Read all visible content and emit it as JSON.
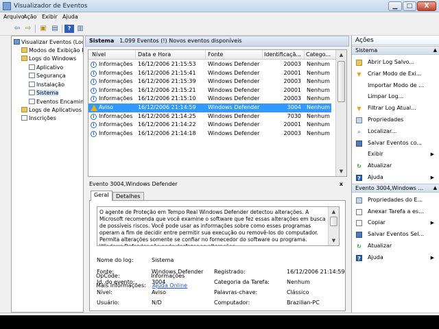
{
  "window": {
    "title": "Visualizador de Eventos"
  },
  "menu": [
    "Arquivo",
    "Ação",
    "Exibir",
    "Ajuda"
  ],
  "tree": [
    {
      "label": "Visualizar Eventos (Local",
      "icon": "monitor-icon",
      "indent": 0
    },
    {
      "label": "Modos de Exibição P",
      "icon": "folder-icon",
      "indent": 1
    },
    {
      "label": "Logs do Windows",
      "icon": "folder-icon",
      "indent": 1
    },
    {
      "label": "Aplicativo",
      "icon": "log-icon",
      "indent": 2
    },
    {
      "label": "Segurança",
      "icon": "log-icon",
      "indent": 2
    },
    {
      "label": "Instalação",
      "icon": "log-icon",
      "indent": 2
    },
    {
      "label": "Sistema",
      "icon": "log-icon",
      "indent": 2,
      "selected": true
    },
    {
      "label": "Eventos Encamin",
      "icon": "log-icon",
      "indent": 2
    },
    {
      "label": "Logs de Aplicativos e",
      "icon": "folder-icon",
      "indent": 1
    },
    {
      "label": "Inscrições",
      "icon": "log-icon",
      "indent": 1
    }
  ],
  "summary": {
    "log": "Sistema",
    "text": "1.099 Eventos (!) Novos eventos disponíveis"
  },
  "grid": {
    "columns": [
      "Nível",
      "Data e Hora",
      "Fonte",
      "Identificaçã...",
      "Catego..."
    ],
    "rows": [
      {
        "level": "Informações",
        "type": "info",
        "date": "16/12/2006 21:15:53",
        "source": "Windows Defender",
        "id": "20003",
        "cat": "Nenhum"
      },
      {
        "level": "Informações",
        "type": "info",
        "date": "16/12/2006 21:15:41",
        "source": "Windows Defender",
        "id": "20001",
        "cat": "Nenhum"
      },
      {
        "level": "Informações",
        "type": "info",
        "date": "16/12/2006 21:15:39",
        "source": "Windows Defender",
        "id": "20003",
        "cat": "Nenhum"
      },
      {
        "level": "Informações",
        "type": "info",
        "date": "16/12/2006 21:15:21",
        "source": "Windows Defender",
        "id": "20001",
        "cat": "Nenhum"
      },
      {
        "level": "Informações",
        "type": "info",
        "date": "16/12/2006 21:15:10",
        "source": "Windows Defender",
        "id": "20003",
        "cat": "Nenhum"
      },
      {
        "level": "Aviso",
        "type": "warn",
        "date": "16/12/2006 21:14:59",
        "source": "Windows Defender",
        "id": "3004",
        "cat": "Nenhum",
        "selected": true
      },
      {
        "level": "Informações",
        "type": "info",
        "date": "16/12/2006 21:14:25",
        "source": "Windows Defender",
        "id": "7030",
        "cat": "Nenhum"
      },
      {
        "level": "Informações",
        "type": "info",
        "date": "16/12/2006 21:14:22",
        "source": "Windows Defender",
        "id": "20001",
        "cat": "Nenhum"
      },
      {
        "level": "Informações",
        "type": "info",
        "date": "16/12/2006 21:14:18",
        "source": "Windows Defender",
        "id": "20003",
        "cat": "Nenhum"
      }
    ]
  },
  "detail": {
    "title": "Evento 3004,Windows Defender",
    "close": "x",
    "tabs": [
      "Geral",
      "Detalhes"
    ],
    "description": "O agente de Proteção em Tempo Real Windows Defender detectou alterações. A Microsoft recomenda que você examine o software que fez essas alterações em busca de possíveis riscos. Você pode usar as informações sobre como esses programas operam a fim de decidir entre permitir sua execução ou removê-los do computador.  Permita alterações somente se confiar no fornecedor do software ou programa. Windows Defender não pode desfazer as alterações",
    "fields": {
      "log_label": "Nome do log:",
      "log_value": "Sistema",
      "source_label": "Fonte:",
      "source_value": "Windows Defender",
      "registered_label": "Registrado:",
      "registered_value": "16/12/2006 21:14:59",
      "id_label": "Id. do evento:",
      "id_value": "3004",
      "task_label": "Categoria da Tarefa:",
      "task_value": "Nenhum",
      "level_label": "Nível:",
      "level_value": "Aviso",
      "keywords_label": "Palavras-chave:",
      "keywords_value": "Clássico",
      "user_label": "Usuário:",
      "user_value": "N/D",
      "computer_label": "Computador:",
      "computer_value": "Brazilian-PC",
      "opcode_label": "OpCode:",
      "opcode_value": "Informações",
      "more_label": "Mais Informações:",
      "more_link": "Ajuda Online"
    }
  },
  "actions": {
    "title": "Ações",
    "sections": [
      {
        "title": "Sistema",
        "items": [
          {
            "label": "Abrir Log Salvo...",
            "icon": "folder-icon"
          },
          {
            "label": "Criar Modo de Exi...",
            "icon": "filter-icon"
          },
          {
            "label": "Importar Modo de ...",
            "icon": ""
          },
          {
            "label": "Limpar Log...",
            "icon": ""
          },
          {
            "label": "Filtrar Log Atual...",
            "icon": "filter-icon"
          },
          {
            "label": "Propriedades",
            "icon": "properties-icon"
          },
          {
            "label": "Localizar...",
            "icon": "find-icon"
          },
          {
            "label": "Salvar Eventos co...",
            "icon": "save-icon"
          },
          {
            "label": "Exibir",
            "icon": "",
            "submenu": true
          },
          {
            "label": "Atualizar",
            "icon": "refresh-icon"
          },
          {
            "label": "Ajuda",
            "icon": "help-icon",
            "submenu": true
          }
        ]
      },
      {
        "title": "Evento 3004,Windows ...",
        "items": [
          {
            "label": "Propriedades do E...",
            "icon": "properties-icon"
          },
          {
            "label": "Anexar Tarefa a es...",
            "icon": "task-icon"
          },
          {
            "label": "Copiar",
            "icon": "copy-icon",
            "submenu": true
          },
          {
            "label": "Salvar Eventos Sel...",
            "icon": "save-icon"
          },
          {
            "label": "Atualizar",
            "icon": "refresh-icon"
          },
          {
            "label": "Ajuda",
            "icon": "help-icon",
            "submenu": true
          }
        ]
      }
    ]
  }
}
